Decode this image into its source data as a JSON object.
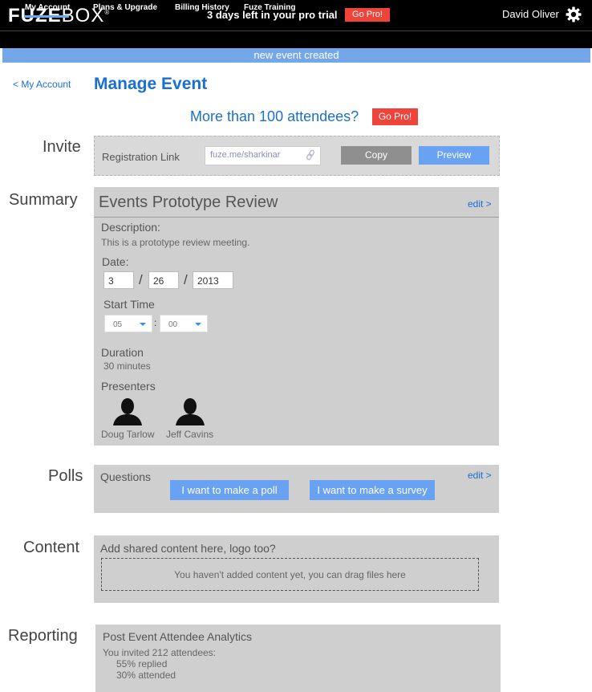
{
  "topbar": {
    "logo_bold": "FUZE",
    "logo_light": "BOX",
    "logo_mark": "®",
    "trial_text": "3 days left in your pro trial",
    "gopro_label": "Go Pro!",
    "user_name": "David Oliver",
    "settings_icon": "gear-icon"
  },
  "nav": {
    "tabs": [
      {
        "label": "My Account"
      },
      {
        "label": "Plans & Upgrade"
      },
      {
        "label": "Billing History"
      },
      {
        "label": "Fuze Training"
      }
    ]
  },
  "banner": {
    "text": "new event created"
  },
  "page": {
    "back_link": "< My Account",
    "title": "Manage Event",
    "promo_text": "More than 100 attendees?",
    "promo_button": "Go Pro!"
  },
  "invite": {
    "section_label": "Invite",
    "reg_label": "Registration Link",
    "reg_value": "fuze.me/sharkinar",
    "link_icon": "link-icon",
    "copy_label": "Copy",
    "preview_label": "Preview"
  },
  "summary": {
    "section_label": "Summary",
    "event_title": "Events Prototype Review",
    "edit_label": "edit >",
    "description_label": "Description:",
    "description_value": "This is a prototype review meeting.",
    "date_label": "Date:",
    "date_month": "3",
    "date_day": "26",
    "date_year": "2013",
    "date_sep": "/",
    "start_label": "Start Time",
    "start_hour": "05",
    "start_minute": "00",
    "time_sep": ":",
    "duration_label": "Duration",
    "duration_value": "30 minutes",
    "presenters_label": "Presenters",
    "presenters": [
      {
        "name": "Doug Tarlow"
      },
      {
        "name": "Jeff Cavins"
      }
    ]
  },
  "polls": {
    "section_label": "Polls",
    "questions_label": "Questions",
    "edit_label": "edit >",
    "poll_button": "I want to make a poll",
    "survey_button": "I want to make a survey"
  },
  "content": {
    "section_label": "Content",
    "heading": "Add shared content here, logo too?",
    "drop_text": "You haven't added content yet, you can drag files here"
  },
  "reporting": {
    "section_label": "Reporting",
    "heading": "Post Event Attendee Analytics",
    "invited_text": "You invited 212 attendees:",
    "replied_text": "55% replied",
    "attended_text": "30% attended"
  },
  "colors": {
    "accent": "#1a6fd1",
    "button_blue": "#6aa2f3",
    "go_pro_red": "#f0433a",
    "panel_gray": "#cfcfcf"
  }
}
